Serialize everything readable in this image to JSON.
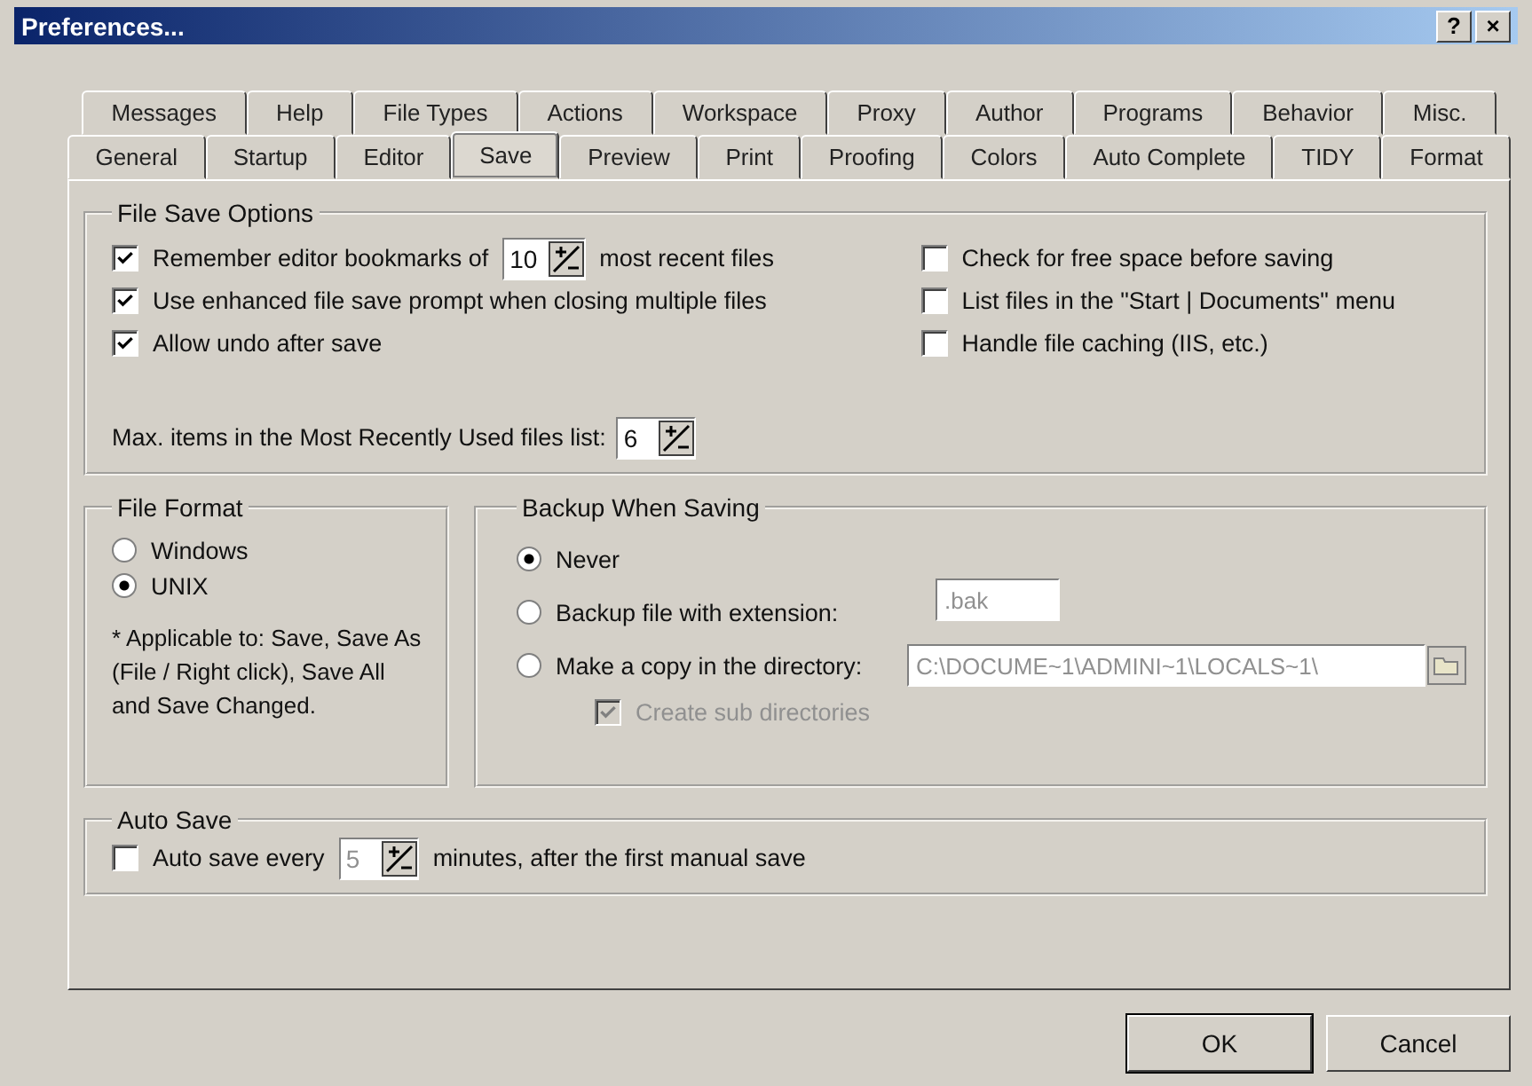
{
  "window": {
    "title": "Preferences...",
    "help_button": "?",
    "close_button": "×"
  },
  "tab_rows": [
    [
      {
        "label": "Messages",
        "selected": false
      },
      {
        "label": "Help",
        "selected": false
      },
      {
        "label": "File Types",
        "selected": false
      },
      {
        "label": "Actions",
        "selected": false
      },
      {
        "label": "Workspace",
        "selected": false
      },
      {
        "label": "Proxy",
        "selected": false
      },
      {
        "label": "Author",
        "selected": false
      },
      {
        "label": "Programs",
        "selected": false
      },
      {
        "label": "Behavior",
        "selected": false
      },
      {
        "label": "Misc.",
        "selected": false
      }
    ],
    [
      {
        "label": "General",
        "selected": false
      },
      {
        "label": "Startup",
        "selected": false
      },
      {
        "label": "Editor",
        "selected": false
      },
      {
        "label": "Save",
        "selected": true
      },
      {
        "label": "Preview",
        "selected": false
      },
      {
        "label": "Print",
        "selected": false
      },
      {
        "label": "Proofing",
        "selected": false
      },
      {
        "label": "Colors",
        "selected": false
      },
      {
        "label": "Auto Complete",
        "selected": false
      },
      {
        "label": "TIDY",
        "selected": false
      },
      {
        "label": "Format",
        "selected": false
      }
    ]
  ],
  "file_save_options": {
    "title": "File Save Options",
    "left_options": [
      {
        "kind": "spin",
        "label": "Remember editor bookmarks of",
        "value": "10",
        "suffix": "most recent files",
        "checked": true
      },
      {
        "kind": "check",
        "label": "Use enhanced file save prompt when closing multiple files",
        "checked": true
      },
      {
        "kind": "check",
        "label": "Allow undo after save",
        "checked": true
      }
    ],
    "right_options": [
      {
        "label": "Check for free space before saving",
        "checked": false
      },
      {
        "label": "List files in the \"Start | Documents\" menu",
        "checked": false
      },
      {
        "label": "Handle file caching (IIS, etc.)",
        "checked": false
      }
    ],
    "mru": {
      "label": "Max. items in the Most Recently Used files list:",
      "value": "6"
    }
  },
  "file_format": {
    "title": "File Format",
    "options": [
      {
        "label": "Windows",
        "selected": false
      },
      {
        "label": "UNIX",
        "selected": true
      }
    ],
    "note": "* Applicable to: Save, Save As (File / Right click), Save All and Save Changed."
  },
  "backup": {
    "title": "Backup When Saving",
    "options": [
      {
        "kind": "plain",
        "label": "Never",
        "selected": true
      },
      {
        "kind": "text",
        "label": "Backup file with extension:",
        "value": ".bak",
        "disabled": true,
        "selected": false
      },
      {
        "kind": "folder",
        "label": "Make a copy in the directory:",
        "value": "C:\\DOCUME~1\\ADMINI~1\\LOCALS~1\\",
        "disabled": true,
        "selected": false
      }
    ],
    "subdirs": {
      "label": "Create sub directories",
      "checked": true,
      "disabled": true
    }
  },
  "auto_save": {
    "title": "Auto Save",
    "checked": false,
    "label": "Auto save every",
    "value": "5",
    "disabled": true,
    "suffix": "minutes, after the first manual save"
  },
  "buttons": [
    {
      "label": "OK",
      "default": true
    },
    {
      "label": "Cancel",
      "default": false
    }
  ]
}
